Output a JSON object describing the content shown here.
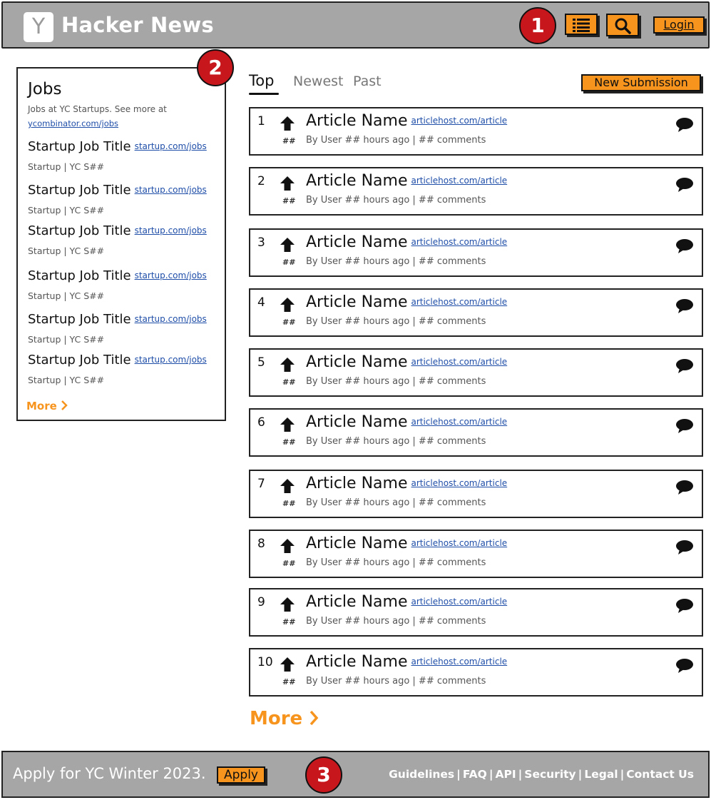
{
  "header": {
    "logo_letter": "Y",
    "title": "Hacker News",
    "login_label": "Login",
    "list_icon": "list-icon",
    "search_icon": "search-icon"
  },
  "markers": [
    "1",
    "2",
    "3"
  ],
  "jobs": {
    "title": "Jobs",
    "description": "Jobs at YC Startups. See more at",
    "link": "ycombinator.com/jobs",
    "items": [
      {
        "title": "Startup Job Title",
        "url": "startup.com/jobs",
        "meta": "Startup | YC S##"
      },
      {
        "title": "Startup Job Title",
        "url": "startup.com/jobs",
        "meta": "Startup | YC S##"
      },
      {
        "title": "Startup Job Title",
        "url": "startup.com/jobs",
        "meta": "Startup | YC S##"
      },
      {
        "title": "Startup Job Title",
        "url": "startup.com/jobs",
        "meta": "Startup | YC S##"
      },
      {
        "title": "Startup Job Title",
        "url": "startup.com/jobs",
        "meta": "Startup | YC S##"
      },
      {
        "title": "Startup Job Title",
        "url": "startup.com/jobs",
        "meta": "Startup | YC S##"
      }
    ],
    "more_label": "More"
  },
  "tabs": {
    "top": "Top",
    "newest": "Newest",
    "past": "Past"
  },
  "new_submission_label": "New Submission",
  "articles": [
    {
      "rank": "1",
      "title": "Article Name",
      "host": "articlehost.com/article",
      "points": "##",
      "meta": "By User ## hours ago | ## comments"
    },
    {
      "rank": "2",
      "title": "Article Name",
      "host": "articlehost.com/article",
      "points": "##",
      "meta": "By User ## hours ago | ## comments"
    },
    {
      "rank": "3",
      "title": "Article Name",
      "host": "articlehost.com/article",
      "points": "##",
      "meta": "By User ## hours ago | ## comments"
    },
    {
      "rank": "4",
      "title": "Article Name",
      "host": "articlehost.com/article",
      "points": "##",
      "meta": "By User ## hours ago | ## comments"
    },
    {
      "rank": "5",
      "title": "Article Name",
      "host": "articlehost.com/article",
      "points": "##",
      "meta": "By User ## hours ago | ## comments"
    },
    {
      "rank": "6",
      "title": "Article Name",
      "host": "articlehost.com/article",
      "points": "##",
      "meta": "By User ## hours ago | ## comments"
    },
    {
      "rank": "7",
      "title": "Article Name",
      "host": "articlehost.com/article",
      "points": "##",
      "meta": "By User ## hours ago | ## comments"
    },
    {
      "rank": "8",
      "title": "Article Name",
      "host": "articlehost.com/article",
      "points": "##",
      "meta": "By User ## hours ago | ## comments"
    },
    {
      "rank": "9",
      "title": "Article Name",
      "host": "articlehost.com/article",
      "points": "##",
      "meta": "By User ## hours ago | ## comments"
    },
    {
      "rank": "10",
      "title": "Article Name",
      "host": "articlehost.com/article",
      "points": "##",
      "meta": "By User ## hours ago | ## comments"
    }
  ],
  "main_more_label": "More",
  "footer": {
    "apply_text": "Apply for YC Winter 2023.",
    "apply_button": "Apply",
    "links": [
      "Guidelines",
      "FAQ",
      "API",
      "Security",
      "Legal",
      "Contact Us"
    ]
  },
  "colors": {
    "header_bg": "#a6a6a6",
    "accent_orange": "#f7941d",
    "marker_red": "#c8161d",
    "link_blue": "#1f4ea8"
  }
}
